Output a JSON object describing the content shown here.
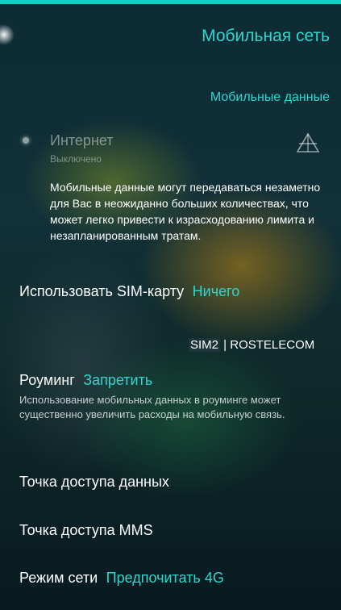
{
  "colors": {
    "accent": "#2fd6d0",
    "topbar": "#1fc9c4"
  },
  "header": {
    "title": "Мобильная сеть"
  },
  "section": {
    "title": "Мобильные данные"
  },
  "internet": {
    "title": "Интернет",
    "status": "Выключено",
    "icon": "network-triangle-icon"
  },
  "warning": {
    "text": "Мобильные данные могут передаваться незаметно для Вас в неожиданно больших количествах, что может легко привести к израсходованию лимита и незапланированным тратам."
  },
  "sim": {
    "label": "Использовать SIM-карту",
    "value": "Ничего",
    "info_part1": "SIM2",
    "info_part2": " | ROSTELECOM"
  },
  "roaming": {
    "label": "Роуминг",
    "value": "Запретить",
    "description": "Использование мобильных данных в роуминге может существенно увеличить расходы на мобильную связь."
  },
  "apn": {
    "label": "Точка доступа данных"
  },
  "mms": {
    "label": "Точка доступа MMS"
  },
  "network_mode": {
    "label": "Режим сети",
    "value": "Предпочитать 4G"
  }
}
